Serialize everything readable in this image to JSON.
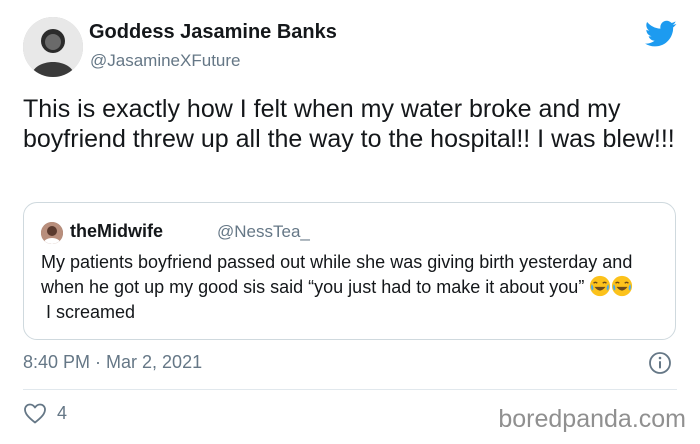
{
  "author": {
    "name": "Goddess Jasamine Banks",
    "handle": "@JasamineXFuture"
  },
  "tweet": {
    "text": "This is exactly how I felt when my water broke and my boyfriend threw up all the way to the hospital!! I was blew!!!"
  },
  "quoted_tweet": {
    "author_name": "theMidwife",
    "author_handle": "@NessTea_",
    "text_before_emoji": "My patients boyfriend passed out while she was giving birth yesterday and when he got up my good sis said “you just had to make it about you”",
    "emoji": [
      "face-with-tears-of-joy",
      "face-with-tears-of-joy"
    ],
    "text_after_emoji": " I screamed"
  },
  "timestamp": "8:40 PM · Mar 2, 2021",
  "likes": {
    "count": "4"
  },
  "watermark": "boredpanda.com",
  "colors": {
    "twitter_blue": "#1d9bf0",
    "text_primary": "#14171a",
    "text_secondary": "#657786",
    "border": "#cfd9de"
  },
  "icons": [
    "twitter-bird-icon",
    "info-icon",
    "heart-icon"
  ]
}
